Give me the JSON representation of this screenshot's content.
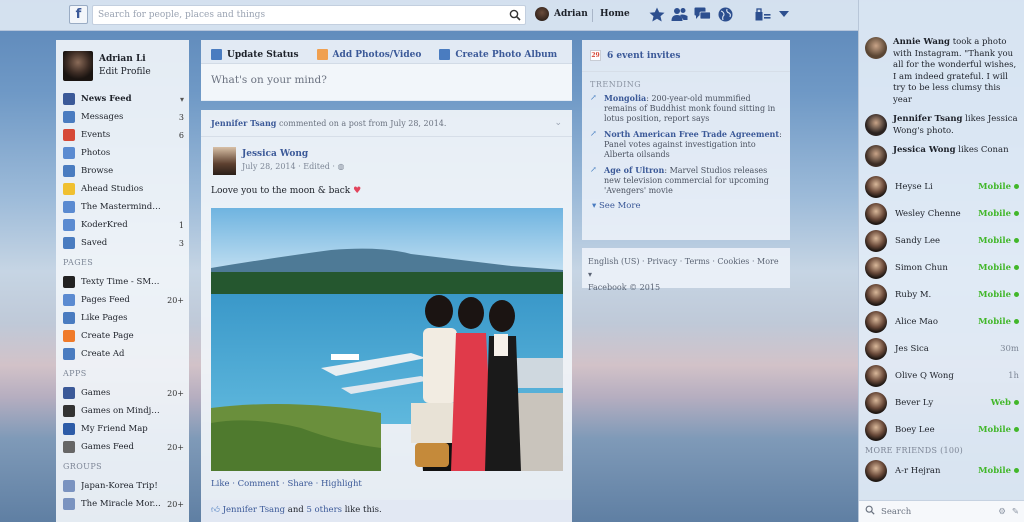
{
  "topbar": {
    "logo": "f",
    "search_placeholder": "Search for people, places and things",
    "user_name": "Adrian",
    "home_label": "Home"
  },
  "profile": {
    "name": "Adrian Li",
    "edit": "Edit Profile"
  },
  "nav": {
    "favorites": [
      {
        "label": "News Feed",
        "count": "",
        "icon": "news-feed-icon",
        "color": "#3b5998"
      },
      {
        "label": "Messages",
        "count": "3",
        "icon": "messages-icon",
        "color": "#4a7cc0"
      },
      {
        "label": "Events",
        "count": "6",
        "icon": "calendar-icon",
        "color": "#d64937"
      },
      {
        "label": "Photos",
        "count": "",
        "icon": "photos-icon",
        "color": "#5b8bd1"
      },
      {
        "label": "Browse",
        "count": "",
        "icon": "search-icon",
        "color": "#4a7cc0"
      },
      {
        "label": "Ahead Studios",
        "count": "",
        "icon": "lightbulb-icon",
        "color": "#f0c030"
      },
      {
        "label": "The Mastermind G...",
        "count": "",
        "icon": "flask-icon",
        "color": "#5b8bd1"
      },
      {
        "label": "KoderKred",
        "count": "1",
        "icon": "flask-icon",
        "color": "#5b8bd1"
      },
      {
        "label": "Saved",
        "count": "3",
        "icon": "bookmark-icon",
        "color": "#4a7cc0"
      }
    ],
    "pages_title": "PAGES",
    "pages": [
      {
        "label": "Texty Time - SMS ...",
        "count": "",
        "icon": "app-icon",
        "color": "#222222"
      },
      {
        "label": "Pages Feed",
        "count": "20+",
        "icon": "pages-feed-icon",
        "color": "#5b8bd1"
      },
      {
        "label": "Like Pages",
        "count": "",
        "icon": "like-icon",
        "color": "#4a7cc0"
      },
      {
        "label": "Create Page",
        "count": "",
        "icon": "create-page-icon",
        "color": "#f07b2a"
      },
      {
        "label": "Create Ad",
        "count": "",
        "icon": "chart-icon",
        "color": "#4a7cc0"
      }
    ],
    "apps_title": "APPS",
    "apps": [
      {
        "label": "Games",
        "count": "20+",
        "icon": "games-icon",
        "color": "#3b5998"
      },
      {
        "label": "Games on Mindjolt",
        "count": "",
        "icon": "mindjolt-icon",
        "color": "#333333"
      },
      {
        "label": "My Friend Map",
        "count": "",
        "icon": "globe-icon",
        "color": "#2d5ca8"
      },
      {
        "label": "Games Feed",
        "count": "20+",
        "icon": "controller-icon",
        "color": "#666666"
      }
    ],
    "groups_title": "GROUPS",
    "groups": [
      {
        "label": "Japan-Korea Trip!",
        "count": "",
        "icon": "group-icon",
        "color": "#7a93c0"
      },
      {
        "label": "The Miracle Mor...",
        "count": "20+",
        "icon": "group-icon",
        "color": "#7a93c0"
      }
    ]
  },
  "composer": {
    "tabs": [
      "Update Status",
      "Add Photos/Video",
      "Create Photo Album"
    ],
    "placeholder": "What's on your mind?"
  },
  "story": {
    "actor": "Jennifer Tsang",
    "header_rest": " commented on a post from July 28, 2014.",
    "poster": "Jessica Wong",
    "meta": "July 28, 2014 · Edited ·",
    "text": "Loove you to the moon & back",
    "heart": "♥",
    "actions": [
      "Like",
      "Comment",
      "Share",
      "Highlight"
    ],
    "likes_name": "Jennifer Tsang",
    "likes_and": " and ",
    "likes_others": "5 others",
    "likes_tail": " like this."
  },
  "right": {
    "events": "6 event invites",
    "events_icon_text": "29",
    "trending_title": "TRENDING",
    "trending": [
      {
        "title": "Mongolia",
        "desc": ": 200-year-old mummified remains of Buddhist monk found sitting in lotus position, report says"
      },
      {
        "title": "North American Free Trade Agreement",
        "desc": ": Panel votes against investigation into Alberta oilsands"
      },
      {
        "title": "Age of Ultron",
        "desc": ": Marvel Studios releases new television commercial for upcoming 'Avengers' movie"
      }
    ],
    "see_more": "See More",
    "footer_links": "English (US) · Privacy · Terms · Cookies · More ▾",
    "copyright": "Facebook © 2015"
  },
  "ticker": [
    {
      "name": "Annie Wang",
      "text": " took a photo with Instagram. \"Thank you all for the wonderful wishes, I am indeed grateful. I will try to be less clumsy this year"
    },
    {
      "name": "Jennifer Tsang",
      "text": " likes Jessica Wong's photo."
    },
    {
      "name": "Jessica Wong",
      "text": " likes Conan"
    }
  ],
  "buddies": [
    {
      "name": "Heyse Li",
      "status": "Mobile",
      "online": true
    },
    {
      "name": "Wesley Chenne",
      "status": "Mobile",
      "online": true
    },
    {
      "name": "Sandy Lee",
      "status": "Mobile",
      "online": true
    },
    {
      "name": "Simon Chun",
      "status": "Mobile",
      "online": true
    },
    {
      "name": "Ruby M.",
      "status": "Mobile",
      "online": true
    },
    {
      "name": "Alice Mao",
      "status": "Mobile",
      "online": true
    },
    {
      "name": "Jes Sica",
      "status": "30m",
      "online": false
    },
    {
      "name": "Olive Q Wong",
      "status": "1h",
      "online": false
    },
    {
      "name": "Bever Ly",
      "status": "Web",
      "online": true
    },
    {
      "name": "Boey Lee",
      "status": "Mobile",
      "online": true
    }
  ],
  "more_friends": "MORE FRIENDS (100)",
  "buddies_more": [
    {
      "name": "A-r Hejran",
      "status": "Mobile",
      "online": true
    }
  ],
  "chat_search_placeholder": "Search"
}
